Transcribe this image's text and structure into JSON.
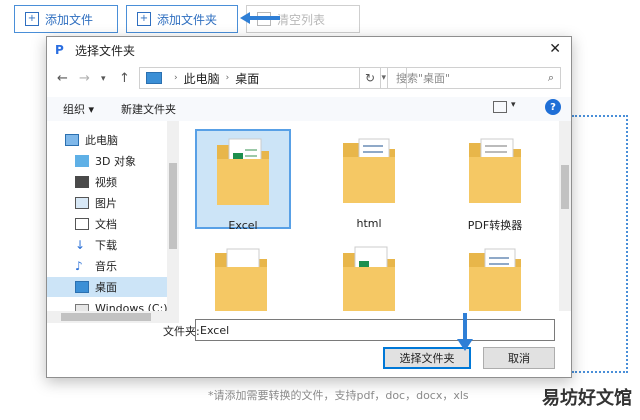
{
  "top_buttons": {
    "add_file": "添加文件",
    "add_folder": "添加文件夹",
    "clear_list": "清空列表"
  },
  "dialog": {
    "title": "选择文件夹",
    "path": [
      "此电脑",
      "桌面"
    ],
    "search_placeholder": "搜索\"桌面\"",
    "toolbar": {
      "organize": "组织 ▾",
      "new_folder": "新建文件夹"
    },
    "sidebar": [
      {
        "label": "此电脑",
        "icon": "computer-icon"
      },
      {
        "label": "3D 对象",
        "icon": "cube-icon"
      },
      {
        "label": "视频",
        "icon": "video-icon"
      },
      {
        "label": "图片",
        "icon": "picture-icon"
      },
      {
        "label": "文档",
        "icon": "document-icon"
      },
      {
        "label": "下载",
        "icon": "download-icon"
      },
      {
        "label": "音乐",
        "icon": "music-icon"
      },
      {
        "label": "桌面",
        "icon": "desktop-icon"
      },
      {
        "label": "Windows (C:)",
        "icon": "drive-icon"
      }
    ],
    "folders": [
      {
        "label": "Excel",
        "selected": true
      },
      {
        "label": "html"
      },
      {
        "label": "PDF转换器"
      },
      {
        "label": ""
      },
      {
        "label": ""
      },
      {
        "label": ""
      }
    ],
    "filename_label": "文件夹:",
    "filename_value": "Excel",
    "select_button": "选择文件夹",
    "cancel_button": "取消"
  },
  "hint": "*请添加需要转换的文件，支持pdf，doc，docx，xls",
  "watermark": "易坊好文馆",
  "colors": {
    "accent": "#4a8fd8",
    "selection": "#cce4f7",
    "folder": "#f5c864"
  }
}
